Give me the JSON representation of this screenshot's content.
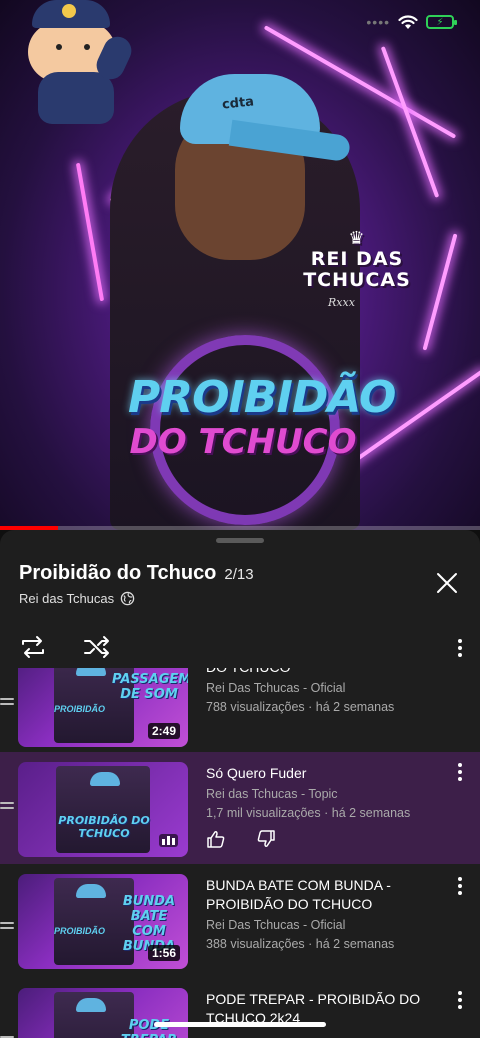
{
  "status_bar": {
    "battery_icon": "battery-charging-icon",
    "wifi_icon": "wifi-icon"
  },
  "video": {
    "brand_text": "REI DAS TCHUCAS",
    "signature": "Rxxx",
    "cap_logo": "cdta",
    "album_title_line1": "PROIBIDÃO",
    "album_title_line2": "DO TCHUCO",
    "progress_percent": 12
  },
  "playlist": {
    "title": "Proibidão do Tchuco",
    "position": "2/13",
    "channel": "Rei das Tchucas"
  },
  "items": [
    {
      "title": "DO TCHUCO",
      "channel": "Rei Das Tchucas - Oficial",
      "views": "788 visualizações · há 2 semanas",
      "duration": "2:49",
      "thumb_text": "PASSAGEM DE SOM",
      "thumb_sub": "PROIBIDÃO"
    },
    {
      "title": "Só Quero Fuder",
      "channel": "Rei das Tchucas - Topic",
      "views": "1,7 mil visualizações · há 2 semanas",
      "thumb_text": "PROIBIDÃO DO TCHUCO"
    },
    {
      "title": "BUNDA BATE COM BUNDA - PROIBIDÃO DO TCHUCO",
      "channel": "Rei Das Tchucas - Oficial",
      "views": "388 visualizações · há 2 semanas",
      "duration": "1:56",
      "thumb_text": "BUNDA BATE COM BUNDA",
      "thumb_sub": "PROIBIDÃO"
    },
    {
      "title": "PODE TREPAR - PROIBIDÃO DO TCHUCO 2k24",
      "thumb_text": "PODE TREPAR"
    }
  ],
  "colors": {
    "accent": "#ff0000",
    "active_row": "#3d1f49",
    "sheet_bg": "#1e1e1e",
    "neon_blue": "#5fd0f0",
    "neon_pink": "#e04bd0"
  }
}
